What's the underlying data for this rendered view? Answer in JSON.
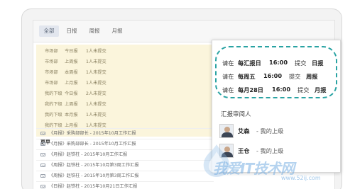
{
  "tabs": [
    {
      "label": "全部",
      "active": true
    },
    {
      "label": "日报",
      "active": false
    },
    {
      "label": "周报",
      "active": false
    },
    {
      "label": "月报",
      "active": false
    }
  ],
  "pending": [
    {
      "who": "市场部",
      "when": "今日报",
      "count": "1人未提交"
    },
    {
      "who": "市场部",
      "when": "上周报",
      "count": "1人未提交"
    },
    {
      "who": "市场部",
      "when": "本周报",
      "count": "1人未提交"
    },
    {
      "who": "市场部",
      "when": "上月报",
      "count": "1人未提交"
    },
    {
      "who": "我的下级",
      "when": "今日报",
      "count": "2人未提交"
    },
    {
      "who": "我的下级",
      "when": "上周报",
      "count": "1人未提交"
    },
    {
      "who": "我的下级",
      "when": "本月报",
      "count": "1人未提交"
    },
    {
      "who": "我的下级",
      "when": "上月报",
      "count": "1人未提交"
    }
  ],
  "section_head": "更早",
  "reports": [
    "《月报》采购部部长 - 2015年10月工作汇报",
    "《月报》采购部部长 - 2015年10月工作汇报",
    "《月报》赵铁柱 - 2015年10月工作汇报",
    "《周报》赵铁柱 - 2015年10月第3周工作汇报",
    "《周报》赵铁柱 - 2015年10月第3周工作汇报",
    "《日报》赵铁柱 - 2015年10月21日工作汇报"
  ],
  "schedule": [
    {
      "pre": "请在",
      "when": "每汇报日",
      "time": "16:00",
      "verb": "提交",
      "kind": "日报"
    },
    {
      "pre": "请在",
      "when": "每周五",
      "time": "16:00",
      "verb": "提交",
      "kind": "周报"
    },
    {
      "pre": "请在",
      "when": "每月28日",
      "time": "16:00",
      "verb": "提交",
      "kind": "月报"
    }
  ],
  "reviewers_title": "汇报审阅人",
  "reviewers": [
    {
      "name": "艾森",
      "role": "- 我的上级"
    },
    {
      "name": "王仓",
      "role": "- 我的上级"
    }
  ],
  "watermark": {
    "text": "我爱IT技术网",
    "url": "www.52ij.com"
  }
}
